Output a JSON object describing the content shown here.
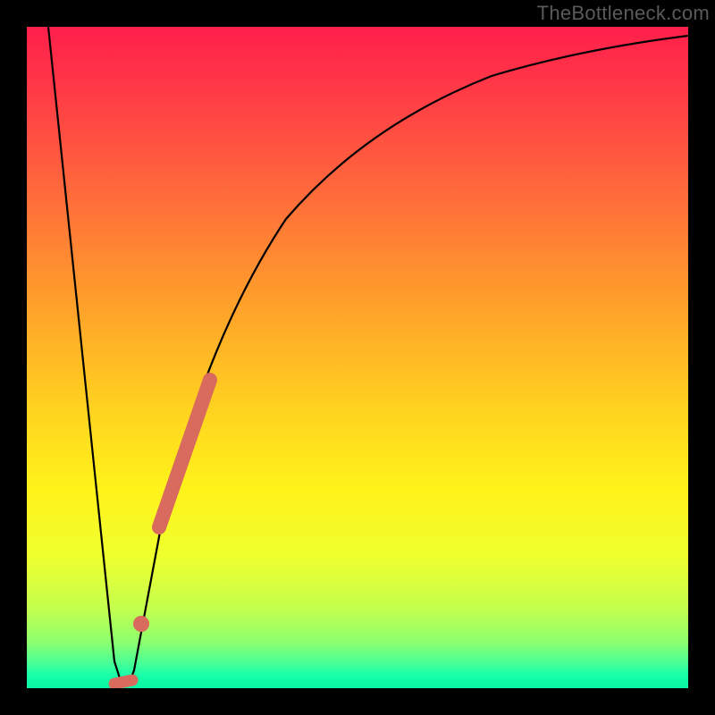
{
  "watermark": {
    "text": "TheBottleneck.com"
  },
  "chart_data": {
    "type": "line",
    "title": "",
    "xlabel": "",
    "ylabel": "",
    "xlim": [
      0,
      100
    ],
    "ylim": [
      0,
      100
    ],
    "series": [
      {
        "name": "bottleneck-curve",
        "x": [
          3,
          5,
          7,
          9,
          11,
          13,
          14,
          15,
          16,
          18,
          20,
          22,
          25,
          28,
          32,
          36,
          40,
          45,
          50,
          55,
          60,
          65,
          70,
          75,
          80,
          85,
          90,
          95,
          100
        ],
        "y": [
          100,
          80,
          60,
          40,
          20,
          5,
          0,
          3,
          10,
          25,
          38,
          48,
          58,
          65,
          72,
          77,
          81,
          85,
          88,
          90,
          91.5,
          93,
          94,
          95,
          95.8,
          96.5,
          97,
          97.4,
          97.8
        ]
      }
    ],
    "markers": [
      {
        "name": "highlight-segment",
        "x_range": [
          20,
          27
        ],
        "y_range": [
          38,
          61
        ],
        "color": "#d96a5e"
      },
      {
        "name": "small-marker-1",
        "x": 16.2,
        "y": 7,
        "color": "#d96a5e"
      },
      {
        "name": "small-marker-2",
        "x": 14.2,
        "y": 0.5,
        "color": "#d96a5e"
      }
    ]
  }
}
